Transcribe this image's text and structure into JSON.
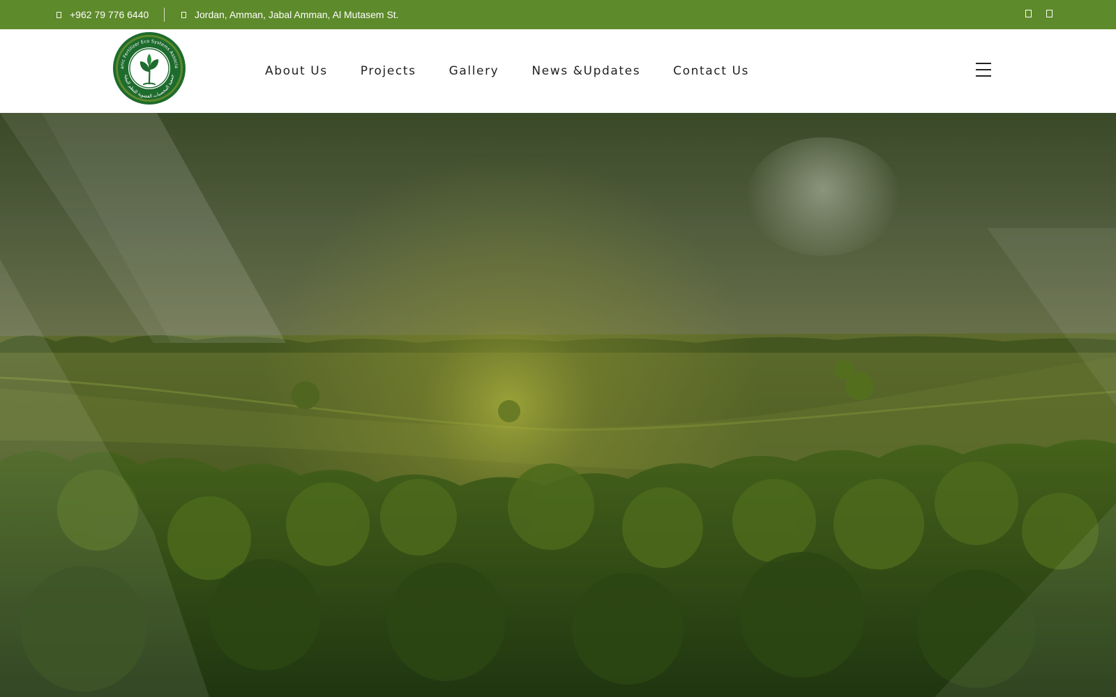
{
  "topbar": {
    "phone": "+962 79 776 6440",
    "address": "Jordan, Amman, Jabal Amman, Al Mutasem St.",
    "phone_icon": "phone-icon",
    "location_icon": "map-pin-icon",
    "social_icons": [
      "facebook-icon",
      "instagram-icon"
    ]
  },
  "header": {
    "logo": {
      "text_en": "Organic Fertilizer Eco Systems Association",
      "text_ar": "جمعية المخصبات العضوية للنظم البيئية"
    },
    "nav": [
      {
        "label": "About Us"
      },
      {
        "label": "Projects"
      },
      {
        "label": "Gallery"
      },
      {
        "label": "News &Updates"
      },
      {
        "label": "Contact Us"
      }
    ],
    "menu_icon": "hamburger-menu-icon"
  },
  "colors": {
    "brand_green": "#5d8a2a",
    "logo_dark_green": "#1e6b2e",
    "nav_text": "#222222"
  }
}
